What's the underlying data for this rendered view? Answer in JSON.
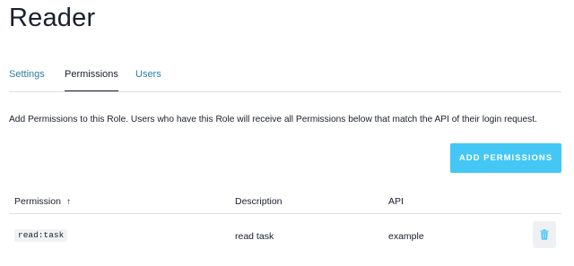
{
  "page": {
    "title": "Reader"
  },
  "tabs": [
    {
      "label": "Settings",
      "active": false
    },
    {
      "label": "Permissions",
      "active": true
    },
    {
      "label": "Users",
      "active": false
    }
  ],
  "description": "Add Permissions to this Role. Users who have this Role will receive all Permissions below that match the API of their login request.",
  "add_button": {
    "label": "ADD PERMISSIONS"
  },
  "table": {
    "columns": [
      {
        "label": "Permission",
        "sort_icon": "↑"
      },
      {
        "label": "Description"
      },
      {
        "label": "API"
      }
    ],
    "rows": [
      {
        "permission": "read:task",
        "description": "read task",
        "api": "example",
        "action_icon": "trash-icon"
      }
    ]
  },
  "colors": {
    "accent": "#44c7f4",
    "link": "#2a7ea3",
    "text": "#1b1f2e",
    "border": "#dfe1e5"
  }
}
